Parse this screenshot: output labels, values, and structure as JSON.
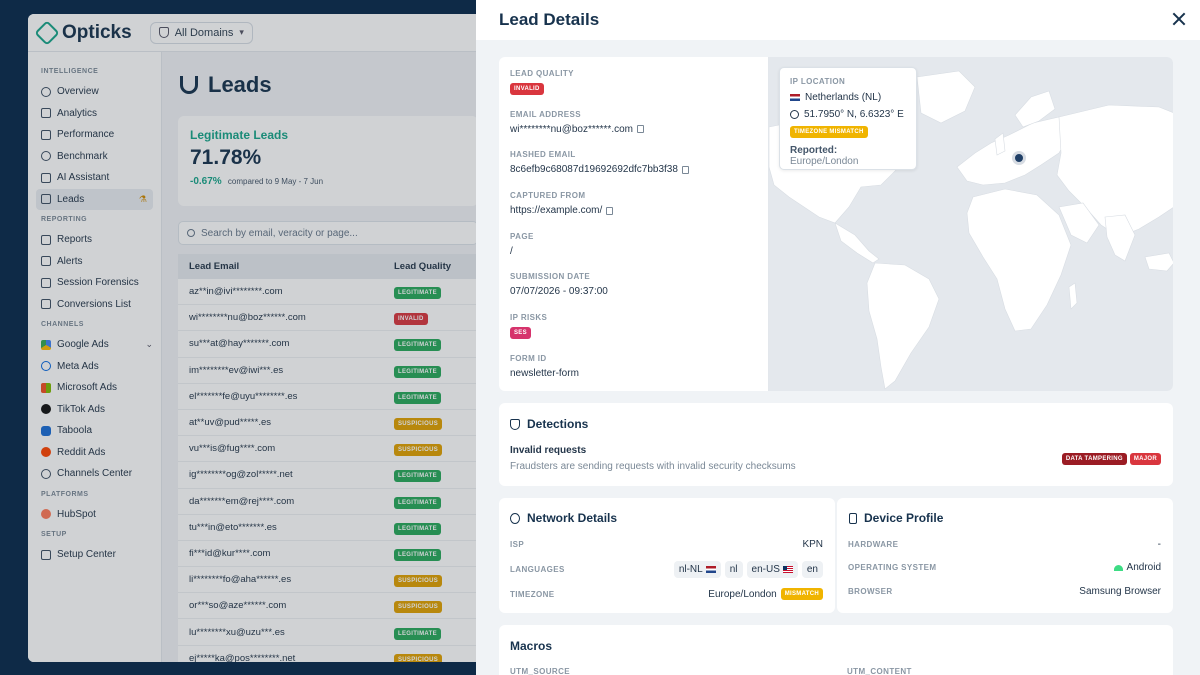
{
  "app": {
    "brand": "Opticks",
    "domain_selector": "All Domains"
  },
  "sidebar": {
    "sections": [
      {
        "title": "INTELLIGENCE",
        "items": [
          {
            "label": "Overview",
            "icon": "target-icon"
          },
          {
            "label": "Analytics",
            "icon": "bar-chart-icon"
          },
          {
            "label": "Performance",
            "icon": "trend-icon"
          },
          {
            "label": "Benchmark",
            "icon": "gauge-icon"
          },
          {
            "label": "AI Assistant",
            "icon": "sparkle-icon"
          },
          {
            "label": "Leads",
            "icon": "magnet-icon",
            "active": true
          }
        ]
      },
      {
        "title": "REPORTING",
        "items": [
          {
            "label": "Reports",
            "icon": "clipboard-icon"
          },
          {
            "label": "Alerts",
            "icon": "bell-icon"
          },
          {
            "label": "Session Forensics",
            "icon": "screen-icon"
          },
          {
            "label": "Conversions List",
            "icon": "list-icon"
          }
        ]
      },
      {
        "title": "CHANNELS",
        "items": [
          {
            "label": "Google Ads",
            "icon": "google-ads-icon"
          },
          {
            "label": "Meta Ads",
            "icon": "meta-icon"
          },
          {
            "label": "Microsoft Ads",
            "icon": "microsoft-icon"
          },
          {
            "label": "TikTok Ads",
            "icon": "tiktok-icon"
          },
          {
            "label": "Taboola",
            "icon": "taboola-icon"
          },
          {
            "label": "Reddit Ads",
            "icon": "reddit-icon"
          },
          {
            "label": "Channels Center",
            "icon": "channels-icon"
          }
        ]
      },
      {
        "title": "PLATFORMS",
        "items": [
          {
            "label": "HubSpot",
            "icon": "hubspot-icon"
          }
        ]
      },
      {
        "title": "SETUP",
        "items": [
          {
            "label": "Setup Center",
            "icon": "shield-icon"
          }
        ]
      }
    ]
  },
  "leads_page": {
    "title": "Leads",
    "kpi": {
      "label": "Legitimate Leads",
      "value": "71.78%",
      "delta": "-0.67%",
      "compare": "compared to 9 May - 7 Jun"
    },
    "search_placeholder": "Search by email, veracity or page...",
    "columns": [
      "Lead Email",
      "Lead Quality"
    ],
    "rows": [
      {
        "email": "az**in@ivi********.com",
        "quality": "LEGITIMATE"
      },
      {
        "email": "wi********nu@boz******.com",
        "quality": "INVALID"
      },
      {
        "email": "su***at@hay*******.com",
        "quality": "LEGITIMATE"
      },
      {
        "email": "im********ev@iwi***.es",
        "quality": "LEGITIMATE"
      },
      {
        "email": "el*******fe@uyu********.es",
        "quality": "LEGITIMATE"
      },
      {
        "email": "at**uv@pud*****.es",
        "quality": "SUSPICIOUS"
      },
      {
        "email": "vu***is@fug****.com",
        "quality": "SUSPICIOUS"
      },
      {
        "email": "ig********og@zol*****.net",
        "quality": "LEGITIMATE"
      },
      {
        "email": "da*******em@rej****.com",
        "quality": "LEGITIMATE"
      },
      {
        "email": "tu***in@eto*******.es",
        "quality": "LEGITIMATE"
      },
      {
        "email": "fi***id@kur****.com",
        "quality": "LEGITIMATE"
      },
      {
        "email": "li********fo@aha******.es",
        "quality": "SUSPICIOUS"
      },
      {
        "email": "or***so@aze******.com",
        "quality": "SUSPICIOUS"
      },
      {
        "email": "lu********xu@uzu***.es",
        "quality": "LEGITIMATE"
      },
      {
        "email": "ej*****ka@pos********.net",
        "quality": "SUSPICIOUS"
      }
    ]
  },
  "drawer": {
    "title": "Lead Details",
    "fields": [
      {
        "label": "LEAD QUALITY",
        "badge": "INVALID"
      },
      {
        "label": "EMAIL ADDRESS",
        "value": "wi********nu@boz******.com",
        "copy": true
      },
      {
        "label": "HASHED EMAIL",
        "value": "8c6efb9c68087d19692692dfc7bb3f38",
        "copy": true
      },
      {
        "label": "CAPTURED FROM",
        "value": "https://example.com/",
        "copy": true
      },
      {
        "label": "PAGE",
        "value": "/"
      },
      {
        "label": "SUBMISSION DATE",
        "value": "07/07/2026 - 09:37:00"
      },
      {
        "label": "IP RISKS",
        "badge": "SES"
      },
      {
        "label": "FORM ID",
        "value": "newsletter-form"
      }
    ],
    "ip_location": {
      "title": "IP LOCATION",
      "country": "Netherlands (NL)",
      "coords": "51.7950° N, 6.6323° E",
      "tz_badge": "TIMEZONE MISMATCH",
      "reported_label": "Reported:",
      "reported_value": "Europe/London"
    },
    "detections": {
      "title": "Detections",
      "name": "Invalid requests",
      "description": "Fraudsters are sending requests with invalid security checksums",
      "tags": [
        "DATA TAMPERING",
        "MAJOR"
      ]
    },
    "network": {
      "title": "Network Details",
      "isp_label": "ISP",
      "isp": "KPN",
      "languages_label": "LANGUAGES",
      "languages": [
        "nl-NL",
        "nl",
        "en-US",
        "en"
      ],
      "timezone_label": "TIMEZONE",
      "timezone": "Europe/London",
      "timezone_badge": "MISMATCH"
    },
    "device": {
      "title": "Device Profile",
      "hardware_label": "HARDWARE",
      "hardware": "-",
      "os_label": "OPERATING SYSTEM",
      "os": "Android",
      "browser_label": "BROWSER",
      "browser": "Samsung Browser"
    },
    "macros": {
      "title": "Macros",
      "keys": [
        "UTM_SOURCE",
        "UTM_CONTENT"
      ]
    }
  },
  "colors": {
    "legit": "#27a85a",
    "invalid": "#d9363e",
    "suspicious": "#e0a100",
    "ses": "#d6336c",
    "brand": "#17a589"
  }
}
